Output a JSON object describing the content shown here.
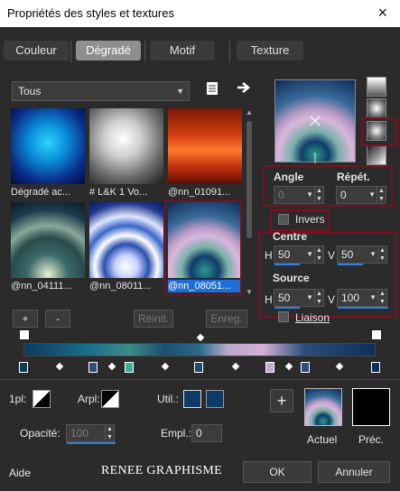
{
  "window": {
    "title": "Propriétés des styles et textures",
    "close": "×"
  },
  "tabs": [
    {
      "label": "Couleur"
    },
    {
      "label": "Dégradé"
    },
    {
      "label": "Motif"
    },
    {
      "label": "Texture"
    }
  ],
  "library": {
    "category": "Tous",
    "thumbnails": [
      {
        "label": "Dégradé ac..."
      },
      {
        "label": "# L&K 1 Vo..."
      },
      {
        "label": "@nn_01091..."
      },
      {
        "label": "@nn_04111..."
      },
      {
        "label": "@nn_08011..."
      },
      {
        "label": "@nn_08051..."
      }
    ],
    "add_label": "+",
    "remove_label": "-",
    "reset_label": "Réinit.",
    "save_label": "Enreg."
  },
  "angle": {
    "label": "Angle",
    "value": "0"
  },
  "repeat": {
    "label": "Répét.",
    "value": "0"
  },
  "invert": {
    "label": "Invers"
  },
  "center": {
    "label": "Centre",
    "h_label": "H",
    "h_value": "50",
    "v_label": "V",
    "v_value": "50"
  },
  "source": {
    "label": "Source",
    "h_label": "H",
    "h_value": "50",
    "v_label": "V",
    "v_value": "100"
  },
  "link": {
    "label": "Liaison"
  },
  "stops_editor": {
    "p1_label": "1pl:",
    "arpl_label": "Arpl:",
    "util_label": "Util.:",
    "opacity_label": "Opacité:",
    "opacity_value": "100",
    "empl_label": "Empl.:",
    "empl_value": "0",
    "add_label": "+"
  },
  "swatches": {
    "current_label": "Actuel",
    "previous_label": "Préc."
  },
  "footer": {
    "help_label": "Aide",
    "brand": "RENEE GRAPHISME",
    "ok_label": "OK",
    "cancel_label": "Annuler"
  },
  "colors": {
    "accent": "#2e7fd8",
    "highlight_box": "#7a1020",
    "util_swatch": "#0f3a66"
  }
}
